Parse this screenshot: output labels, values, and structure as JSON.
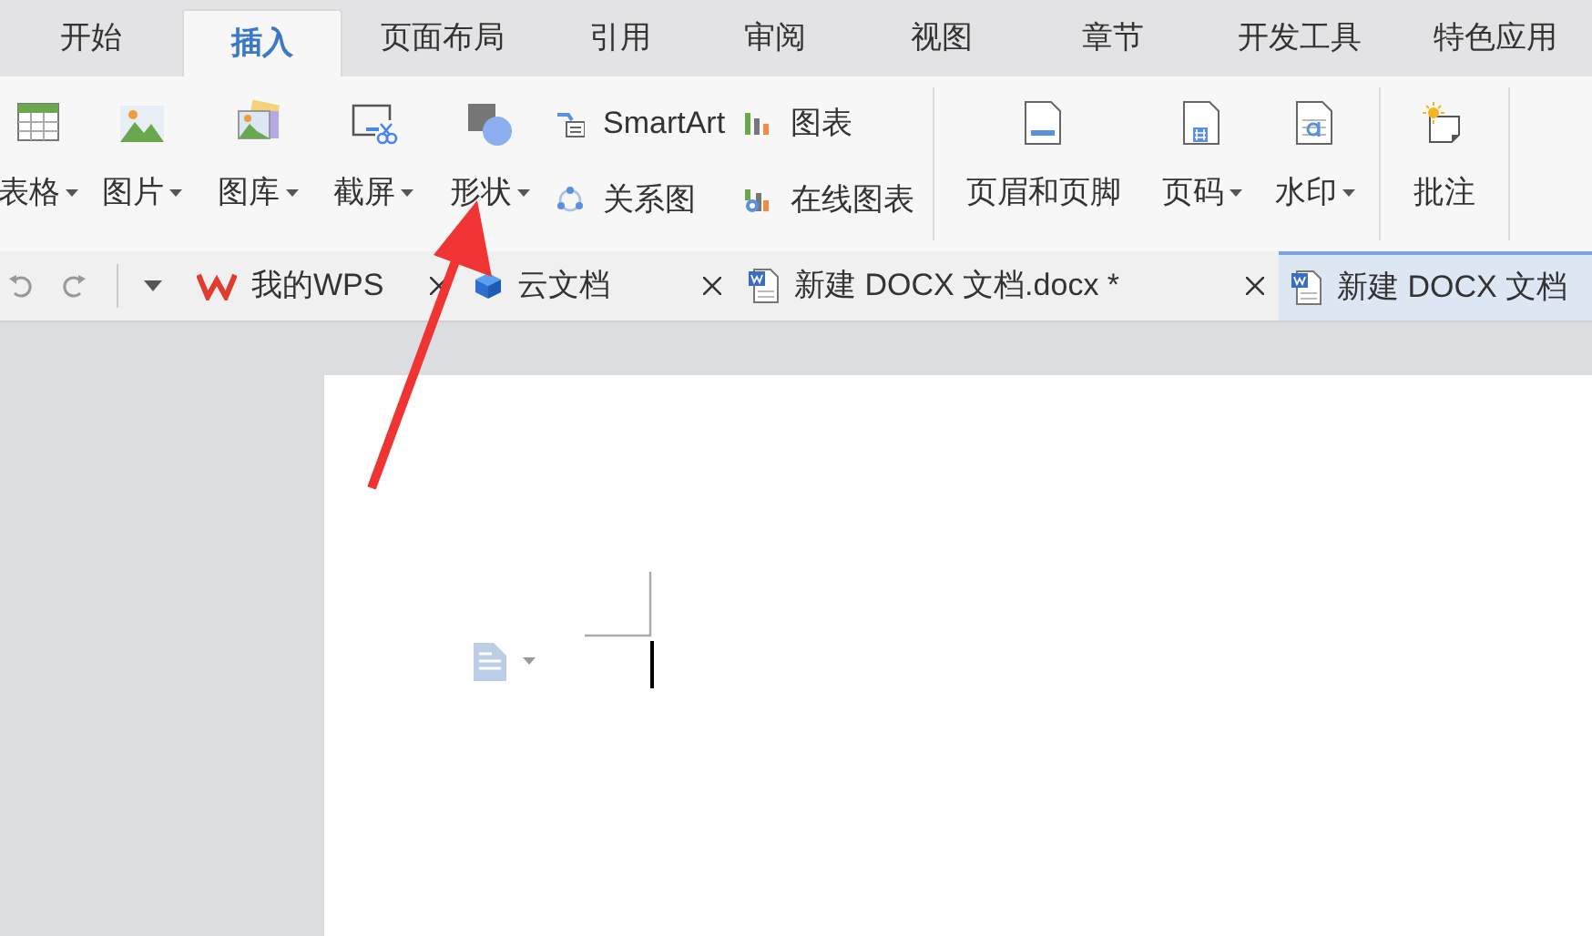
{
  "menu_tabs": [
    {
      "label": "开始",
      "selected": false
    },
    {
      "label": "插入",
      "selected": true
    },
    {
      "label": "页面布局",
      "selected": false
    },
    {
      "label": "引用",
      "selected": false
    },
    {
      "label": "审阅",
      "selected": false
    },
    {
      "label": "视图",
      "selected": false
    },
    {
      "label": "章节",
      "selected": false
    },
    {
      "label": "开发工具",
      "selected": false
    },
    {
      "label": "特色应用",
      "selected": false
    }
  ],
  "ribbon": [
    {
      "kind": "big",
      "label": "表格",
      "dropdown": true
    },
    {
      "kind": "big",
      "label": "图片",
      "dropdown": true
    },
    {
      "kind": "big",
      "label": "图库",
      "dropdown": true
    },
    {
      "kind": "big",
      "label": "截屏",
      "dropdown": true
    },
    {
      "kind": "big",
      "label": "形状",
      "dropdown": true
    },
    {
      "kind": "pair",
      "items": [
        {
          "label": "SmartArt"
        },
        {
          "label": "关系图"
        }
      ]
    },
    {
      "kind": "pair",
      "items": [
        {
          "label": "图表"
        },
        {
          "label": "在线图表"
        }
      ]
    },
    {
      "kind": "separator"
    },
    {
      "kind": "big",
      "label": "页眉和页脚",
      "dropdown": false
    },
    {
      "kind": "big",
      "label": "页码",
      "dropdown": true
    },
    {
      "kind": "big",
      "label": "水印",
      "dropdown": true
    },
    {
      "kind": "separator"
    },
    {
      "kind": "big",
      "label": "批注",
      "dropdown": false
    },
    {
      "kind": "separator"
    }
  ],
  "doc_tabs": [
    {
      "kind": "home",
      "label": "我的WPS",
      "selected": false,
      "closable": true
    },
    {
      "kind": "cloud",
      "label": "云文档",
      "selected": false,
      "closable": true
    },
    {
      "kind": "document",
      "label": "新建 DOCX 文档.docx *",
      "selected": false,
      "closable": true
    },
    {
      "kind": "document",
      "label": "新建 DOCX 文档",
      "selected": true,
      "closable": false
    }
  ]
}
